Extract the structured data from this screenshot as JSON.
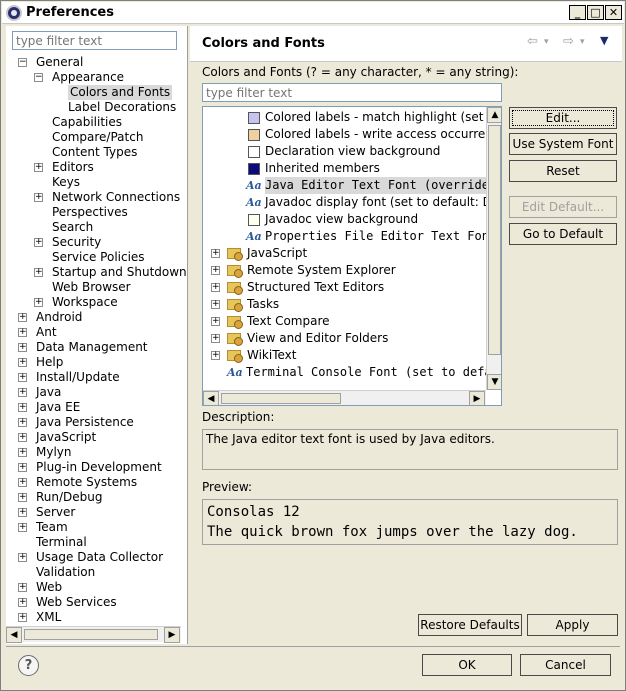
{
  "window": {
    "title": "Preferences"
  },
  "left": {
    "filter_placeholder": "type filter text",
    "tree": [
      {
        "label": "General",
        "depth": 0,
        "toggle": "−"
      },
      {
        "label": "Appearance",
        "depth": 1,
        "toggle": "−"
      },
      {
        "label": "Colors and Fonts",
        "depth": 2,
        "toggle": "",
        "selected": true
      },
      {
        "label": "Label Decorations",
        "depth": 2,
        "toggle": ""
      },
      {
        "label": "Capabilities",
        "depth": 1,
        "toggle": ""
      },
      {
        "label": "Compare/Patch",
        "depth": 1,
        "toggle": ""
      },
      {
        "label": "Content Types",
        "depth": 1,
        "toggle": ""
      },
      {
        "label": "Editors",
        "depth": 1,
        "toggle": "+"
      },
      {
        "label": "Keys",
        "depth": 1,
        "toggle": ""
      },
      {
        "label": "Network Connections",
        "depth": 1,
        "toggle": "+"
      },
      {
        "label": "Perspectives",
        "depth": 1,
        "toggle": ""
      },
      {
        "label": "Search",
        "depth": 1,
        "toggle": ""
      },
      {
        "label": "Security",
        "depth": 1,
        "toggle": "+"
      },
      {
        "label": "Service Policies",
        "depth": 1,
        "toggle": ""
      },
      {
        "label": "Startup and Shutdown",
        "depth": 1,
        "toggle": "+"
      },
      {
        "label": "Web Browser",
        "depth": 1,
        "toggle": ""
      },
      {
        "label": "Workspace",
        "depth": 1,
        "toggle": "+"
      },
      {
        "label": "Android",
        "depth": 0,
        "toggle": "+"
      },
      {
        "label": "Ant",
        "depth": 0,
        "toggle": "+"
      },
      {
        "label": "Data Management",
        "depth": 0,
        "toggle": "+"
      },
      {
        "label": "Help",
        "depth": 0,
        "toggle": "+"
      },
      {
        "label": "Install/Update",
        "depth": 0,
        "toggle": "+"
      },
      {
        "label": "Java",
        "depth": 0,
        "toggle": "+"
      },
      {
        "label": "Java EE",
        "depth": 0,
        "toggle": "+"
      },
      {
        "label": "Java Persistence",
        "depth": 0,
        "toggle": "+"
      },
      {
        "label": "JavaScript",
        "depth": 0,
        "toggle": "+"
      },
      {
        "label": "Mylyn",
        "depth": 0,
        "toggle": "+"
      },
      {
        "label": "Plug-in Development",
        "depth": 0,
        "toggle": "+"
      },
      {
        "label": "Remote Systems",
        "depth": 0,
        "toggle": "+"
      },
      {
        "label": "Run/Debug",
        "depth": 0,
        "toggle": "+"
      },
      {
        "label": "Server",
        "depth": 0,
        "toggle": "+"
      },
      {
        "label": "Team",
        "depth": 0,
        "toggle": "+"
      },
      {
        "label": "Terminal",
        "depth": 0,
        "toggle": ""
      },
      {
        "label": "Usage Data Collector",
        "depth": 0,
        "toggle": "+"
      },
      {
        "label": "Validation",
        "depth": 0,
        "toggle": ""
      },
      {
        "label": "Web",
        "depth": 0,
        "toggle": "+"
      },
      {
        "label": "Web Services",
        "depth": 0,
        "toggle": "+"
      },
      {
        "label": "XML",
        "depth": 0,
        "toggle": "+"
      }
    ]
  },
  "right": {
    "title": "Colors and Fonts",
    "filter_label": "Colors and Fonts (? = any character, * = any string):",
    "filter_placeholder": "type filter text",
    "items": [
      {
        "kind": "color",
        "color": "#c5c5f0",
        "label": "Colored labels - match highlight (set to"
      },
      {
        "kind": "color",
        "color": "#f0d0a0",
        "label": "Colored labels - write access occurren"
      },
      {
        "kind": "color",
        "color": "#ffffff",
        "label": "Declaration view background"
      },
      {
        "kind": "color",
        "color": "#0a0a7a",
        "label": "Inherited members"
      },
      {
        "kind": "font",
        "label": "Java Editor Text Font (overrides",
        "mono": true,
        "selected": true
      },
      {
        "kind": "font",
        "label": "Javadoc display font (set to default: Dia",
        "mono": false
      },
      {
        "kind": "color",
        "color": "#ffffef",
        "label": "Javadoc view background"
      },
      {
        "kind": "font",
        "label": "Properties File Editor Text Font",
        "mono": true
      },
      {
        "kind": "folder",
        "label": "JavaScript"
      },
      {
        "kind": "folder",
        "label": "Remote System Explorer"
      },
      {
        "kind": "folder",
        "label": "Structured Text Editors"
      },
      {
        "kind": "folder",
        "label": "Tasks"
      },
      {
        "kind": "folder",
        "label": "Text Compare"
      },
      {
        "kind": "folder",
        "label": "View and Editor Folders"
      },
      {
        "kind": "folder",
        "label": "WikiText"
      },
      {
        "kind": "font-root",
        "label": "Terminal Console Font (set to defa",
        "mono": true
      }
    ],
    "buttons": {
      "edit": "Edit...",
      "use_system_font": "Use System Font",
      "reset": "Reset",
      "edit_default": "Edit Default...",
      "go_to_default": "Go to Default"
    },
    "description_label": "Description:",
    "description_text": "The Java editor text font is used by Java editors.",
    "preview_label": "Preview:",
    "preview_lines": [
      "Consolas 12",
      "The quick brown fox jumps over the lazy dog."
    ],
    "restore_defaults": "Restore Defaults",
    "apply": "Apply"
  },
  "footer": {
    "ok": "OK",
    "cancel": "Cancel"
  },
  "colors": {
    "accent": "#2a5a9b",
    "chrome": "#ece9d8",
    "selection": "#d9d9d9"
  },
  "icons": {
    "help": "question-icon",
    "back": "back-arrow-icon",
    "forward": "forward-arrow-icon",
    "view_menu": "view-menu-icon"
  }
}
